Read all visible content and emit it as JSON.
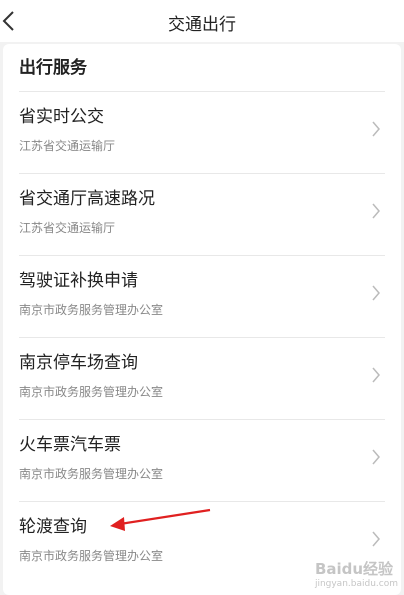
{
  "header": {
    "title": "交通出行",
    "back_icon": "chevron-left-icon"
  },
  "section": {
    "title": "出行服务"
  },
  "items": [
    {
      "title": "省实时公交",
      "subtitle": "江苏省交通运输厅"
    },
    {
      "title": "省交通厅高速路况",
      "subtitle": "江苏省交通运输厅"
    },
    {
      "title": "驾驶证补换申请",
      "subtitle": "南京市政务服务管理办公室"
    },
    {
      "title": "南京停车场查询",
      "subtitle": "南京市政务服务管理办公室"
    },
    {
      "title": "火车票汽车票",
      "subtitle": "南京市政务服务管理办公室"
    },
    {
      "title": "轮渡查询",
      "subtitle": "南京市政务服务管理办公室"
    }
  ],
  "annotation": {
    "arrow_color": "#e02020"
  },
  "watermark": {
    "brand": "Baidu经验",
    "url": "jingyan.baidu.com"
  },
  "colors": {
    "background": "#f2f2f2",
    "panel": "#ffffff",
    "divider": "#e8e8e8",
    "subtitle": "#888888"
  }
}
